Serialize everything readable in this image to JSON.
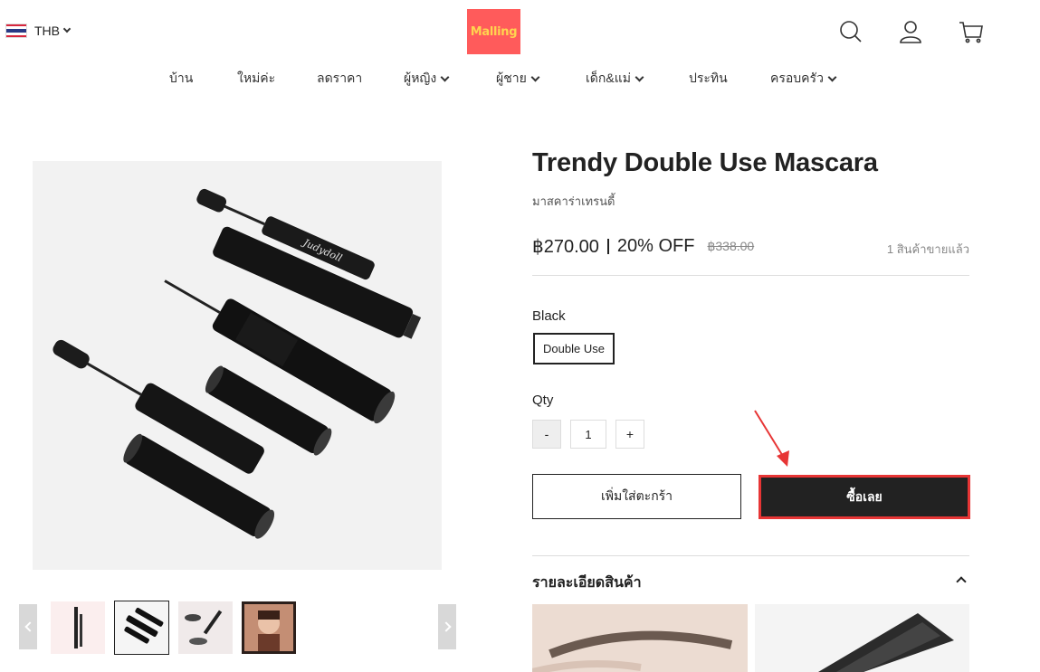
{
  "header": {
    "currency": "THB",
    "logo_text": "Malling",
    "icons": [
      "search-icon",
      "user-icon",
      "cart-icon"
    ]
  },
  "nav": {
    "items": [
      {
        "label": "บ้าน"
      },
      {
        "label": "ใหม่ค่ะ"
      },
      {
        "label": "ลดราคา"
      },
      {
        "label": "ผู้หญิง"
      },
      {
        "label": "ผู้ชาย"
      },
      {
        "label": "เด็ก&แม่"
      },
      {
        "label": "ประทิน"
      },
      {
        "label": "ครอบครัว"
      }
    ]
  },
  "product": {
    "title": "Trendy Double Use Mascara",
    "subtitle": "มาสคาร่าเทรนดี้",
    "price": "฿270.00",
    "discount": "20% OFF",
    "original_price": "฿338.00",
    "sold": "1 สินค้าขายแล้ว",
    "color_label": "Black",
    "variant": "Double Use",
    "qty_label": "Qty",
    "qty_minus": "-",
    "qty_value": "1",
    "qty_plus": "+",
    "add_to_cart": "เพิ่มใส่ตะกร้า",
    "buy_now": "ซื้อเลย",
    "details_title": "รายละเอียดสินค้า",
    "brand_print": "Judydoll"
  },
  "colors": {
    "accent": "#222222",
    "highlight": "#e73535",
    "logo_bg": "#ff5b5b",
    "logo_text": "#ffd44f"
  }
}
